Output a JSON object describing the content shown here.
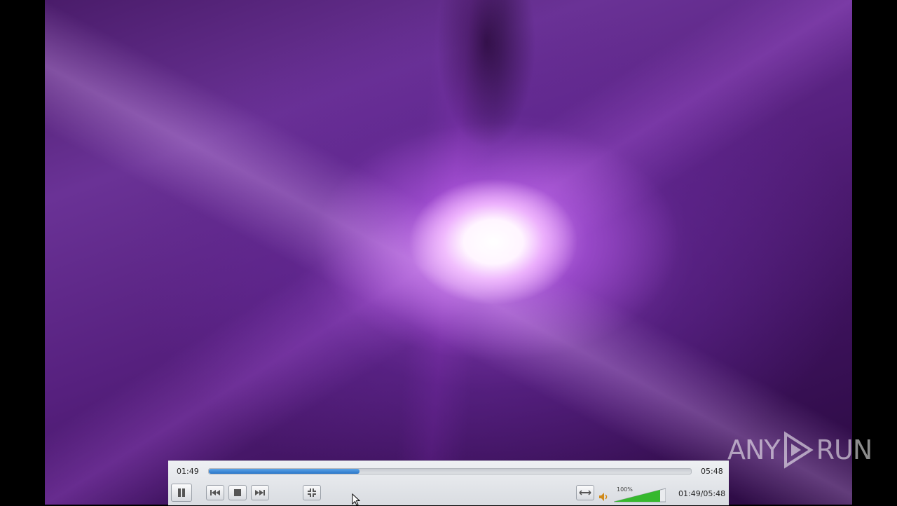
{
  "player": {
    "current_time": "01:49",
    "total_time": "05:48",
    "time_display": "01:49/05:48",
    "progress_fraction": 0.313,
    "volume_label": "100%",
    "volume_fraction": 1.0,
    "accent_color": "#2a76c8",
    "volume_color": "#36b82e"
  },
  "controls": {
    "play_pause_icon": "pause-icon",
    "previous_icon": "previous-track-icon",
    "stop_icon": "stop-icon",
    "next_icon": "next-track-icon",
    "fullscreen_icon": "exit-fullscreen-icon",
    "extended_icon": "extended-settings-icon",
    "mute_icon": "speaker-icon"
  },
  "watermark": {
    "text_left": "ANY",
    "text_right": "RUN"
  }
}
